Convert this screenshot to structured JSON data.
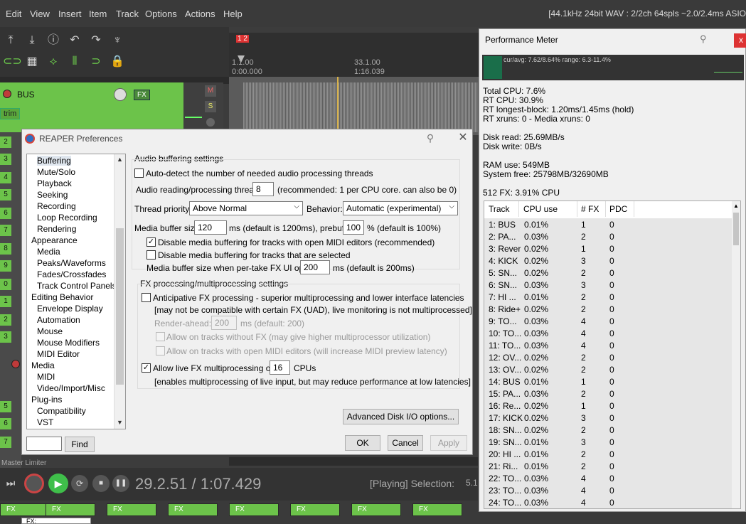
{
  "menu": [
    "Edit",
    "View",
    "Insert",
    "Item",
    "Track",
    "Options",
    "Actions",
    "Help"
  ],
  "status": "[44.1kHz 24bit WAV : 2/2ch 64spls ~2.0/2.4ms ASIO",
  "ruler": {
    "marker": "1 2",
    "t1_bar": "1.1.00",
    "t1_time": "0:00.000",
    "t2_bar": "33.1.00",
    "t2_time": "1:16.039"
  },
  "bus": {
    "name": "BUS",
    "fx": "FX",
    "trim": "trim",
    "m": "M",
    "s": "S"
  },
  "track_numbers": [
    "2",
    "3",
    "4",
    "5",
    "6",
    "7",
    "8",
    "9",
    "0",
    "1",
    "2",
    "3"
  ],
  "lower_tracks": [
    "5",
    "6",
    "7"
  ],
  "transport": {
    "time": "29.2.51 / 1:07.429",
    "state": "[Playing] Selection:",
    "sel": "5.1",
    "master": "Master Limiter"
  },
  "fx_label": "FX",
  "prefs": {
    "title": "REAPER Preferences",
    "tree": [
      {
        "label": "Buffering",
        "indent": true,
        "selected": true
      },
      {
        "label": "Mute/Solo",
        "indent": true
      },
      {
        "label": "Playback",
        "indent": true
      },
      {
        "label": "Seeking",
        "indent": true
      },
      {
        "label": "Recording",
        "indent": true
      },
      {
        "label": "Loop Recording",
        "indent": true
      },
      {
        "label": "Rendering",
        "indent": true
      },
      {
        "label": "Appearance",
        "indent": false
      },
      {
        "label": "Media",
        "indent": true
      },
      {
        "label": "Peaks/Waveforms",
        "indent": true
      },
      {
        "label": "Fades/Crossfades",
        "indent": true
      },
      {
        "label": "Track Control Panels",
        "indent": true
      },
      {
        "label": "Editing Behavior",
        "indent": false
      },
      {
        "label": "Envelope Display",
        "indent": true
      },
      {
        "label": "Automation",
        "indent": true
      },
      {
        "label": "Mouse",
        "indent": true
      },
      {
        "label": "Mouse Modifiers",
        "indent": true
      },
      {
        "label": "MIDI Editor",
        "indent": true
      },
      {
        "label": "Media",
        "indent": false
      },
      {
        "label": "MIDI",
        "indent": true
      },
      {
        "label": "Video/Import/Misc",
        "indent": true
      },
      {
        "label": "Plug-ins",
        "indent": false
      },
      {
        "label": "Compatibility",
        "indent": true
      },
      {
        "label": "VST",
        "indent": true
      }
    ],
    "find_btn": "Find",
    "find_value": "",
    "section_audio": "Audio buffering settings",
    "auto_detect": "Auto-detect the number of needed audio processing threads",
    "threads_label": "Audio reading/processing threads:",
    "threads_value": "8",
    "threads_hint": "(recommended: 1 per CPU core. can also be 0)",
    "priority_label": "Thread priority:",
    "priority_value": "Above Normal",
    "behavior_label": "Behavior:",
    "behavior_value": "Automatic (experimental)",
    "media_buf_label": "Media buffer size:",
    "media_buf_value": "120",
    "media_buf_hint": "ms (default is 1200ms), prebuffer:",
    "prebuf_value": "100",
    "prebuf_hint": "% (default is 100%)",
    "disable_midi": "Disable media buffering for tracks with open MIDI editors (recommended)",
    "disable_sel": "Disable media buffering for tracks that are selected",
    "pertake_label": "Media buffer size when per-take FX UI open:",
    "pertake_value": "200",
    "pertake_hint": "ms (default is 200ms)",
    "section_fx": "FX processing/multiprocessing settings",
    "anticipative": "Anticipative FX processing - superior multiprocessing and lower interface latencies",
    "anticipative_note": "[may not be compatible with certain FX (UAD), live monitoring is not multiprocessed]",
    "render_ahead_label": "Render-ahead:",
    "render_ahead_value": "200",
    "render_ahead_hint": "ms (default: 200)",
    "allow_nofx": "Allow on tracks without FX (may give higher multiprocessor utilization)",
    "allow_midi": "Allow on tracks with open MIDI editors (will increase MIDI preview latency)",
    "live_fx": "Allow live FX multiprocessing on:",
    "live_fx_value": "16",
    "live_fx_unit": "CPUs",
    "live_fx_note": "[enables multiprocessing of live input, but may reduce performance at low latencies]",
    "advanced_btn": "Advanced Disk I/O options...",
    "ok": "OK",
    "cancel": "Cancel",
    "apply": "Apply"
  },
  "perf": {
    "title": "Performance Meter",
    "graph_text": "cur/avg: 7.62/8.64%  range: 6.3-11.4%",
    "total_cpu": "Total CPU: 7.6%",
    "rt_cpu": "RT CPU: 30.9%",
    "rt_block": "RT longest-block: 1.20ms/1.45ms (hold)",
    "rt_xruns": "RT xruns: 0 - Media xruns: 0",
    "disk_read": "Disk read: 25.69MB/s",
    "disk_write": "Disk write: 0B/s",
    "ram": "RAM use: 549MB",
    "sys_free": "System free: 25798MB/32690MB",
    "fx_summary": "512 FX: 3.91% CPU",
    "cols": [
      "Track",
      "CPU use",
      "# FX",
      "PDC"
    ],
    "rows": [
      [
        "1: BUS",
        "0.01%",
        "1",
        "0"
      ],
      [
        "2: PA...",
        "0.03%",
        "2",
        "0"
      ],
      [
        "3: Rever",
        "0.02%",
        "1",
        "0"
      ],
      [
        "4: KICK",
        "0.02%",
        "3",
        "0"
      ],
      [
        "5: SN...",
        "0.02%",
        "2",
        "0"
      ],
      [
        "6: SN...",
        "0.03%",
        "3",
        "0"
      ],
      [
        "7: HI ...",
        "0.01%",
        "2",
        "0"
      ],
      [
        "8: Ride+",
        "0.02%",
        "2",
        "0"
      ],
      [
        "9: TO...",
        "0.03%",
        "4",
        "0"
      ],
      [
        "10: TO...",
        "0.03%",
        "4",
        "0"
      ],
      [
        "11: TO...",
        "0.03%",
        "4",
        "0"
      ],
      [
        "12: OV...",
        "0.02%",
        "2",
        "0"
      ],
      [
        "13: OV...",
        "0.02%",
        "2",
        "0"
      ],
      [
        "14: BUS",
        "0.01%",
        "1",
        "0"
      ],
      [
        "15: PA...",
        "0.03%",
        "2",
        "0"
      ],
      [
        "16: Re...",
        "0.02%",
        "1",
        "0"
      ],
      [
        "17: KICK",
        "0.02%",
        "3",
        "0"
      ],
      [
        "18: SN...",
        "0.02%",
        "2",
        "0"
      ],
      [
        "19: SN...",
        "0.01%",
        "3",
        "0"
      ],
      [
        "20: HI ...",
        "0.01%",
        "2",
        "0"
      ],
      [
        "21: Ri...",
        "0.01%",
        "2",
        "0"
      ],
      [
        "22: TO...",
        "0.03%",
        "4",
        "0"
      ],
      [
        "23: TO...",
        "0.03%",
        "4",
        "0"
      ],
      [
        "24: TO...",
        "0.03%",
        "4",
        "0"
      ]
    ]
  },
  "tooltip": "FX:"
}
